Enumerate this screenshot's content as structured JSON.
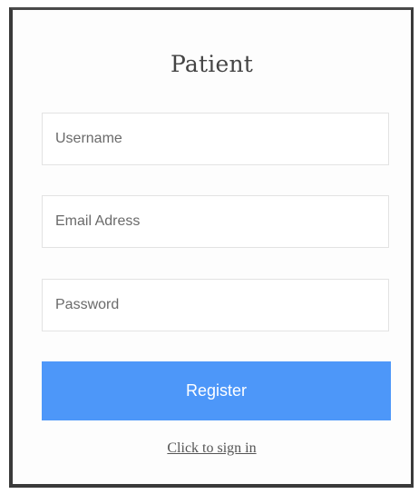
{
  "form": {
    "title": "Patient",
    "fields": {
      "username": {
        "placeholder": "Username",
        "value": ""
      },
      "email": {
        "placeholder": "Email Adress",
        "value": ""
      },
      "password": {
        "placeholder": "Password",
        "value": ""
      }
    },
    "register_label": "Register",
    "signin_label": "Click to sign in"
  },
  "colors": {
    "accent": "#4d97f9",
    "border": "#3a3a3a",
    "field_border": "#e3e3e3",
    "title_text": "#444444"
  }
}
